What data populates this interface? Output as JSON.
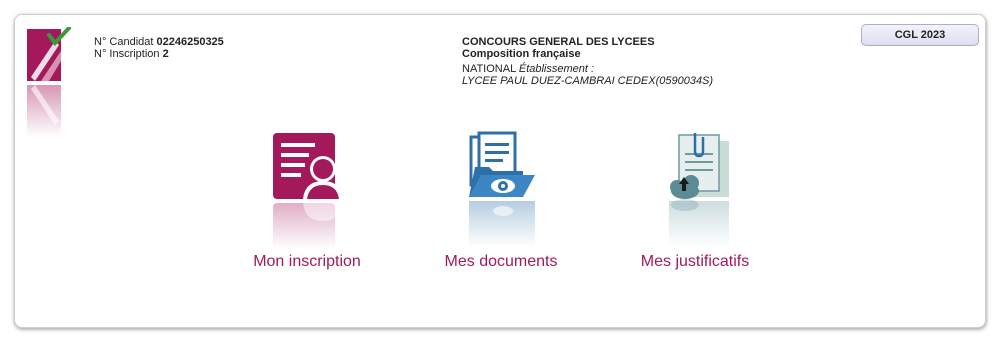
{
  "candidate": {
    "candidat_label": "N° Candidat",
    "candidat_number": "02246250325",
    "inscription_label": "N° Inscription",
    "inscription_number": "2"
  },
  "concours": {
    "title": "CONCOURS GENERAL DES LYCEES",
    "subject": "Composition française",
    "level": "NATIONAL",
    "etablissement_label": "Établissement :",
    "etablissement": "LYCEE PAUL DUEZ-CAMBRAI CEDEX(0590034S)"
  },
  "badge": {
    "label": "CGL 2023"
  },
  "tiles": [
    {
      "label": "Mon inscription",
      "icon": "inscription-icon"
    },
    {
      "label": "Mes documents",
      "icon": "documents-icon"
    },
    {
      "label": "Mes justificatifs",
      "icon": "justificatifs-icon"
    }
  ],
  "colors": {
    "accent": "#a3195b",
    "blue": "#2f6fa8",
    "teal": "#5b8c94"
  }
}
